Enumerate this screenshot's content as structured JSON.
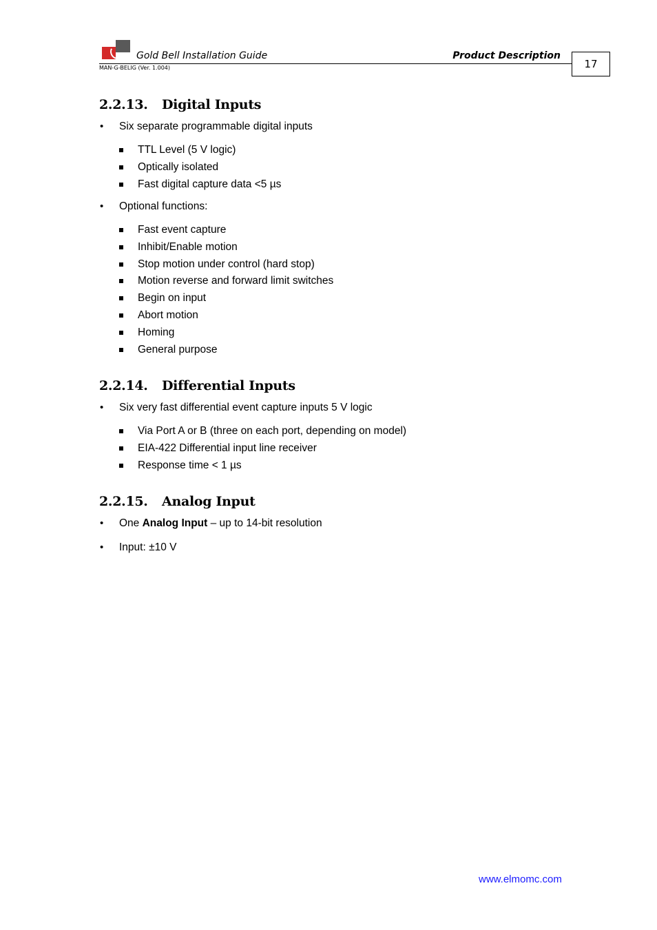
{
  "header": {
    "title": "Gold Bell Installation Guide",
    "section": "Product Description",
    "doc_id": "MAN-G-BELIG (Ver. 1.004)",
    "page_number": "17",
    "logo": "elmo-logo-icon"
  },
  "sections": [
    {
      "number": "2.2.13.",
      "title": "Digital Inputs",
      "items": [
        {
          "text": "Six separate programmable digital inputs",
          "sub": [
            "TTL Level (5 V logic)",
            "Optically isolated",
            "Fast digital capture data <5 µs"
          ]
        },
        {
          "text": "Optional functions:",
          "sub": [
            "Fast event capture",
            "Inhibit/Enable motion",
            "Stop motion under control (hard stop)",
            "Motion reverse and forward limit switches",
            "Begin on input",
            "Abort motion",
            "Homing",
            "General purpose"
          ]
        }
      ]
    },
    {
      "number": "2.2.14.",
      "title": "Differential Inputs",
      "items": [
        {
          "text": "Six very fast differential event capture inputs 5 V logic",
          "sub": [
            "Via Port A or B (three on each port, depending on model)",
            "EIA-422 Differential input line receiver",
            "Response time < 1 µs"
          ]
        }
      ]
    },
    {
      "number": "2.2.15.",
      "title": "Analog Input",
      "items": [
        {
          "pre": "One ",
          "bold": "Analog Input",
          "post": " – up to 14-bit resolution"
        },
        {
          "text": "Input: ±10 V"
        }
      ]
    }
  ],
  "footer": {
    "url": "www.elmomc.com",
    "link_color": "#1a1aff"
  }
}
